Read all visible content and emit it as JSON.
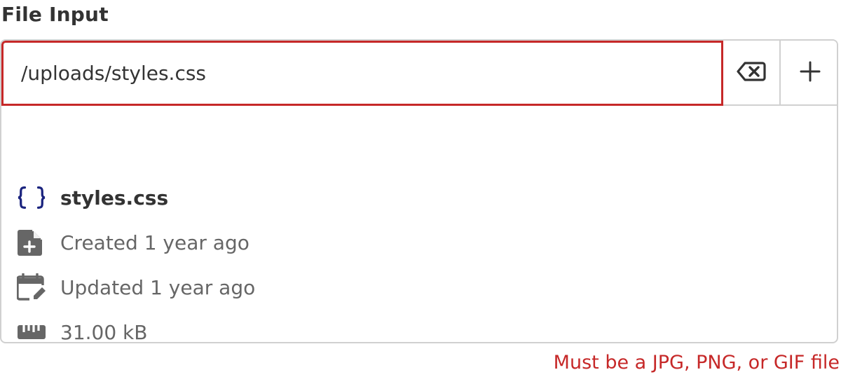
{
  "field": {
    "label": "File Input",
    "value": "/uploads/styles.css"
  },
  "buttons": {
    "clear_icon": "backspace-icon",
    "add_icon": "plus-icon"
  },
  "file": {
    "name": "styles.css",
    "created": "Created 1 year ago",
    "updated": "Updated 1 year ago",
    "size": "31.00 kB"
  },
  "icons": {
    "file_type": "code-braces-icon",
    "created": "file-plus-icon",
    "updated": "calendar-edit-icon",
    "size": "ruler-icon"
  },
  "error": {
    "message": "Must be a JPG, PNG, or GIF file"
  },
  "colors": {
    "error": "#c62828",
    "border": "#d0d0d0",
    "code_icon": "#1a237e",
    "text": "#333333",
    "muted": "#666666"
  }
}
